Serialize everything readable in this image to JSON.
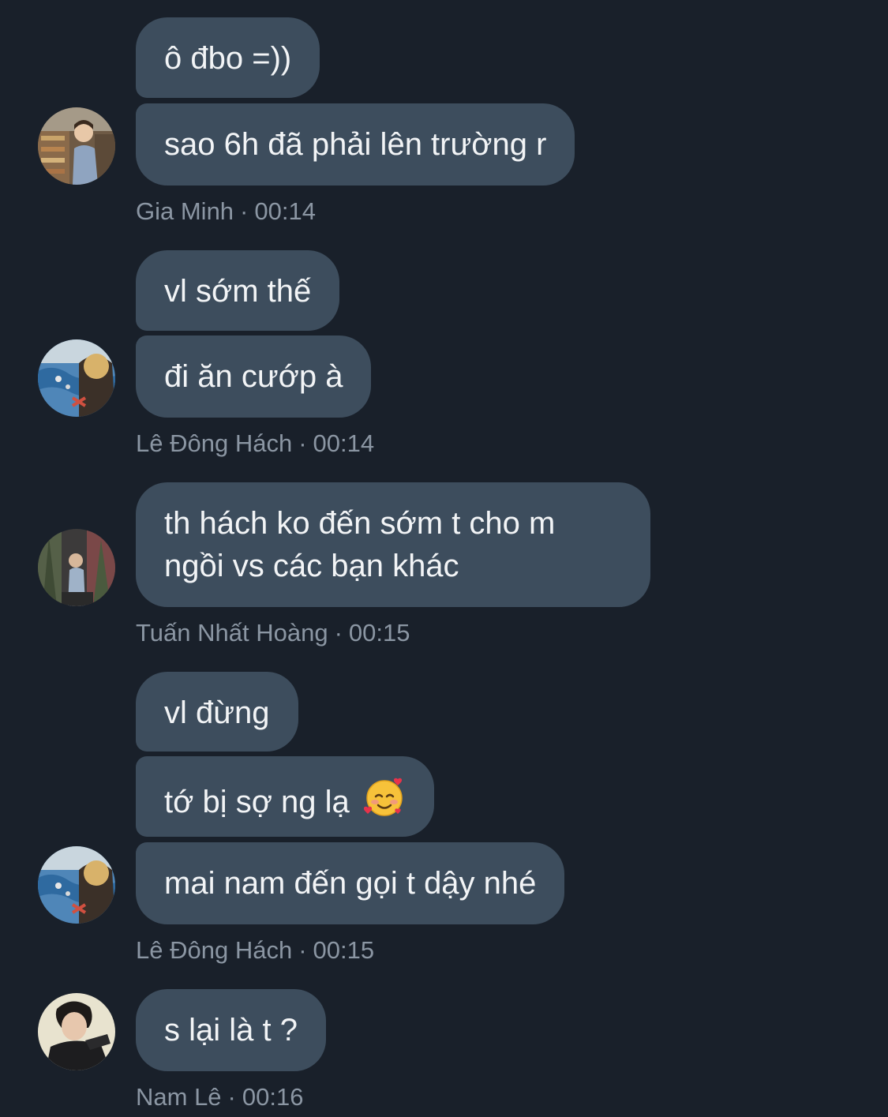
{
  "messages": [
    {
      "sender": "Gia Minh",
      "time": "00:14",
      "avatar_icon": "user-avatar-photo-store",
      "bubbles": [
        "ô đbo =))",
        "sao 6h đã phải lên trường r"
      ]
    },
    {
      "sender": "Lê Đông Hách",
      "time": "00:14",
      "avatar_icon": "user-avatar-photo-pool",
      "bubbles": [
        "vl sớm thế",
        "đi ăn cướp à"
      ]
    },
    {
      "sender": "Tuấn Nhất Hoàng",
      "time": "00:15",
      "avatar_icon": "user-avatar-photo-trees",
      "bubbles": [
        "th hách ko đến sớm t cho m ngồi vs các bạn khác"
      ]
    },
    {
      "sender": "Lê Đông Hách",
      "time": "00:15",
      "avatar_icon": "user-avatar-photo-pool",
      "bubbles": [
        "vl đừng",
        "tớ bị sợ ng lạ",
        "mai nam đến gọi t dậy nhé"
      ],
      "emoji_icon": "smiling-face-with-hearts-emoji"
    },
    {
      "sender": "Nam Lê",
      "time": "00:16",
      "avatar_icon": "user-avatar-photo-portrait",
      "bubbles": [
        "s lại là t ?"
      ]
    }
  ],
  "meta_separator": "·",
  "colors": {
    "background": "#19202a",
    "bubble": "#3d4d5d",
    "bubble_text": "#f2f4f6",
    "meta_text": "#8b96a3"
  }
}
